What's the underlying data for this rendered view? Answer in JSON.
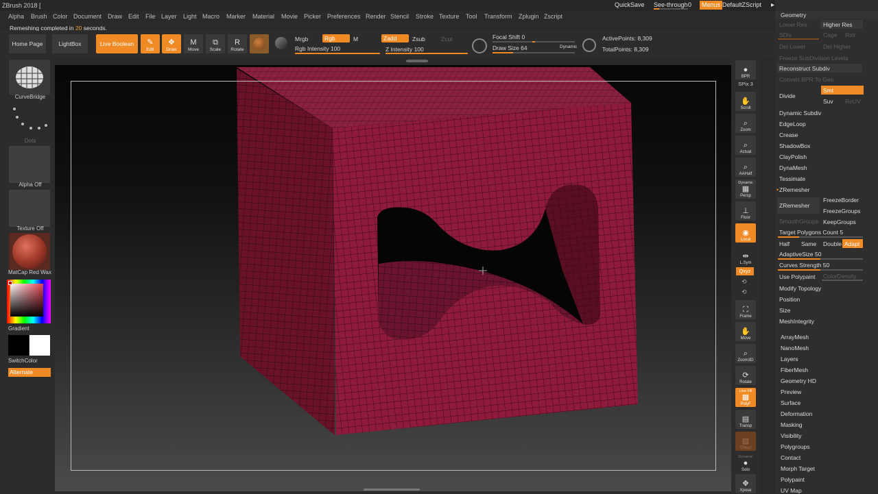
{
  "app": {
    "title": "ZBrush 2018 ["
  },
  "topbar": {
    "quicksave": "QuickSave",
    "see_through": "See-through",
    "see_through_val": "0",
    "menus": "Menus",
    "script": "DefaultZScript"
  },
  "menu": [
    "Alpha",
    "Brush",
    "Color",
    "Document",
    "Draw",
    "Edit",
    "File",
    "Layer",
    "Light",
    "Macro",
    "Marker",
    "Material",
    "Movie",
    "Picker",
    "Preferences",
    "Render",
    "Stencil",
    "Stroke",
    "Texture",
    "Tool",
    "Transform",
    "Zplugin",
    "Zscript"
  ],
  "status": {
    "prefix": "Remeshing completed in",
    "seconds": "20",
    "suffix": "seconds."
  },
  "toolbar": {
    "home": "Home Page",
    "lightbox": "LightBox",
    "live_boolean": "Live Boolean",
    "edit": "Edit",
    "draw": "Draw",
    "move": "Move",
    "scale": "Scale",
    "rotate": "Rotate",
    "mrgb": "Mrgb",
    "rgb": "Rgb",
    "m": "M",
    "rgb_intensity": "Rgb Intensity 100",
    "zadd": "Zadd",
    "zsub": "Zsub",
    "zcut": "Zcut",
    "z_intensity": "Z Intensity 100",
    "focal_shift": "Focal Shift 0",
    "draw_size": "Draw Size 64",
    "dynamic": "Dynamic",
    "active_points": "ActivePoints: 8,309",
    "total_points": "TotalPoints: 8,309",
    "rgb_intensity_val": 1.0,
    "z_intensity_val": 1.0,
    "draw_size_val": 0.25
  },
  "left": {
    "brush": "CurveBridge",
    "stroke": "Dots",
    "alpha": "Alpha Off",
    "texture": "Texture Off",
    "material": "MatCap Red Wax",
    "gradient": "Gradient",
    "switch_color": "SwitchColor",
    "alternate": "Alternate"
  },
  "shelf": {
    "bpr": "BPR",
    "spix": "SPix 3",
    "scroll": "Scroll",
    "zoom": "Zoom",
    "actual": "Actual",
    "aahalf": "AAHalf",
    "persp": "Persp",
    "dynamic": "Dynamic",
    "floor": "Floor",
    "local": "Local",
    "lsym": "L.Sym",
    "xyz": "Qxyz",
    "frame": "Frame",
    "move": "Move",
    "zoom3d": "Zoom3D",
    "rotate": "Rotate",
    "line_fill": "Line Fill",
    "polyf": "PolyF",
    "transp": "Transp",
    "ghost": "Ghost",
    "solo": "Solo",
    "xpose": "Xpose"
  },
  "tool": {
    "geometry": "Geometry",
    "lower_res": "Lower Res",
    "higher_res": "Higher Res",
    "sdiv": "SDiv",
    "cage": "Cage",
    "rstr": "Rstr",
    "del_lower": "Del Lower",
    "del_higher": "Del Higher",
    "freeze_subdiv": "Freeze SubDivision Levels",
    "reconstruct": "Reconstruct Subdiv",
    "convert_bpr": "Convert BPR To Geo",
    "divide": "Divide",
    "smt": "Smt",
    "suv": "Suv",
    "reuv": "ReUV",
    "items": [
      "Dynamic Subdiv",
      "EdgeLoop",
      "Crease",
      "ShadowBox",
      "ClayPolish",
      "DynaMesh",
      "Tessimate"
    ],
    "zremesher_header": "ZRemesher",
    "zremesher": "ZRemesher",
    "freeze_border": "FreezeBorder",
    "freeze_groups": "FreezeGroups",
    "smooth_groups": "SmoothGroups",
    "keep_groups": "KeepGroups",
    "target_count": "Target Polygons Count 5",
    "half": "Half",
    "same": "Same",
    "double": "Double",
    "adapt": "Adapt",
    "adaptive_size": "AdaptiveSize 50",
    "curves_strength": "Curves Strength 50",
    "use_polypaint": "Use Polypaint",
    "color_density": "ColorDensity",
    "items2": [
      "Modify Topology",
      "Position",
      "Size",
      "MeshIntegrity"
    ],
    "subpalettes": [
      "ArrayMesh",
      "NanoMesh",
      "Layers",
      "FiberMesh",
      "Geometry HD",
      "Preview",
      "Surface",
      "Deformation",
      "Masking",
      "Visibility",
      "Polygroups",
      "Contact",
      "Morph Target",
      "Polypaint",
      "UV Map"
    ],
    "target_val": 0.25,
    "adaptive_val": 0.5,
    "curves_val": 0.5
  },
  "colors": {
    "accent": "#f08a24",
    "mesh": "#8a1f3a",
    "wire": "#2a0812"
  }
}
